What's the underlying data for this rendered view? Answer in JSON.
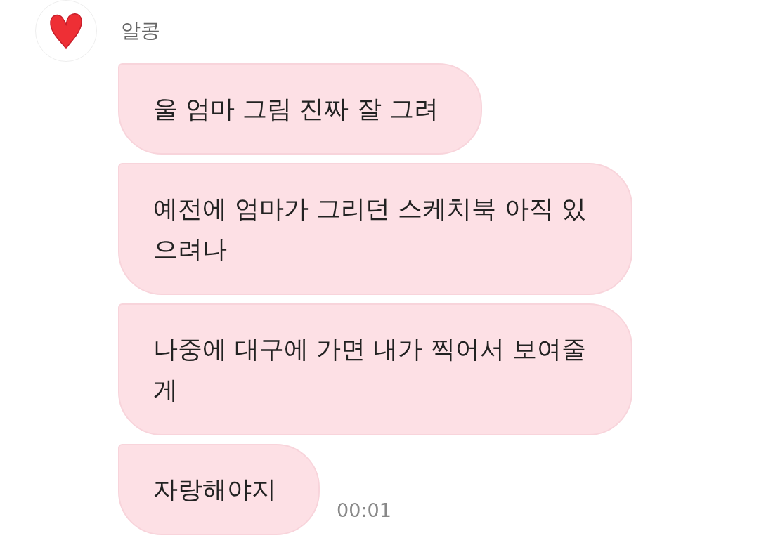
{
  "sender": {
    "name": "알콩"
  },
  "messages": [
    {
      "text": "울 엄마 그림 진짜 잘 그려"
    },
    {
      "text": "예전에 엄마가 그리던 스케치북 아직 있으려나"
    },
    {
      "text": "나중에 대구에 가면 내가 찍어서 보여줄게"
    },
    {
      "text": "자랑해야지",
      "time": "00:01"
    }
  ]
}
